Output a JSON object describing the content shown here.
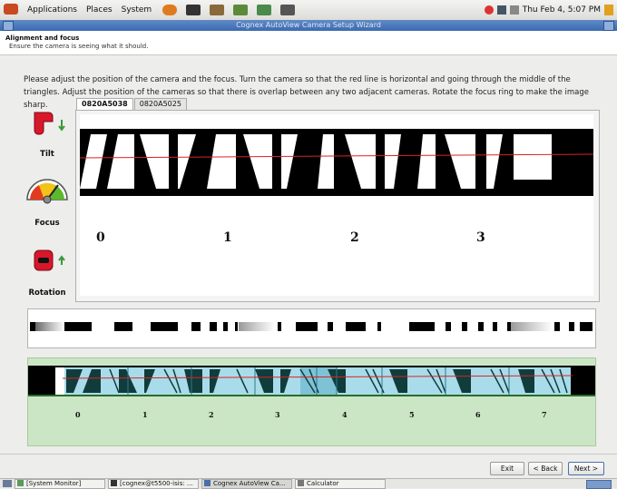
{
  "top_panel": {
    "menu": [
      "Applications",
      "Places",
      "System"
    ],
    "clock": "Thu Feb  4,  5:07 PM"
  },
  "window": {
    "title": "Cognex AutoView Camera Setup Wizard"
  },
  "header": {
    "title": "Alignment and focus",
    "subtitle": "Ensure the camera is seeing what it should."
  },
  "instructions": "Please adjust the position of the camera and the focus. Turn the camera so that the red line is horizontal and going through the middle of the triangles. Adjust the position of the cameras so that there is overlap between any two adjacent cameras. Rotate the focus ring to make the image sharp.",
  "tabs": [
    "0820A5038",
    "0820A5025"
  ],
  "left_panel": {
    "tilt_label": "Tilt",
    "focus_label": "Focus",
    "rotation_label": "Rotation"
  },
  "camera_view": {
    "numbers": [
      "0",
      "1",
      "2",
      "3"
    ]
  },
  "overview": {
    "numbers": [
      "0",
      "1",
      "2",
      "3",
      "4",
      "5",
      "6",
      "7"
    ]
  },
  "buttons": {
    "exit": "Exit",
    "back": "< Back",
    "next": "Next >"
  },
  "taskbar": {
    "tasks": [
      "[System Monitor]",
      "[cognex@t5500-isis: ...",
      "Cognex AutoView Ca...",
      "Calculator"
    ]
  }
}
